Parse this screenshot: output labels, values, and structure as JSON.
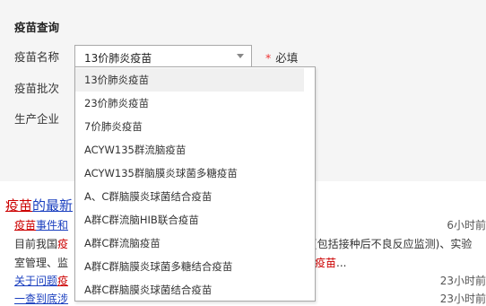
{
  "form": {
    "title": "疫苗查询",
    "name_label": "疫苗名称",
    "batch_label": "疫苗批次",
    "maker_label": "生产企业",
    "selected_value": "13价肺炎疫苗",
    "required_note": "必填",
    "required_star": "*"
  },
  "dropdown": {
    "options": [
      "13价肺炎疫苗",
      "23价肺炎疫苗",
      "7价肺炎疫苗",
      "ACYW135群流脑疫苗",
      "ACYW135群脑膜炎球菌多糖疫苗",
      "A、C群脑膜炎球菌结合疫苗",
      "A群C群流脑HIB联合疫苗",
      "A群C群流脑疫苗",
      "A群C群脑膜炎球菌多糖结合疫苗",
      "A群C群脑膜炎球菌结合疫苗"
    ],
    "selected_index": 0
  },
  "news": {
    "heading_hl": "疫苗",
    "heading_rest": "的最新",
    "item1_hl": "疫苗",
    "item1_rest": "事件和",
    "item1_time": "6小时前",
    "line2_left_a": "目前我国",
    "line2_left_hl": "疫",
    "line2_right": "(包括接种后不良反应监测)、实验",
    "line3_left": "室管理、监",
    "line3_hl": "疫苗",
    "line3_ellipsis": "...",
    "item2_left": "关于问题",
    "item2_hl": "疫",
    "item2_time": "23小时前",
    "item3_left": "一查到底",
    "item3_tail": "涉",
    "item3_time": "23小时前"
  }
}
